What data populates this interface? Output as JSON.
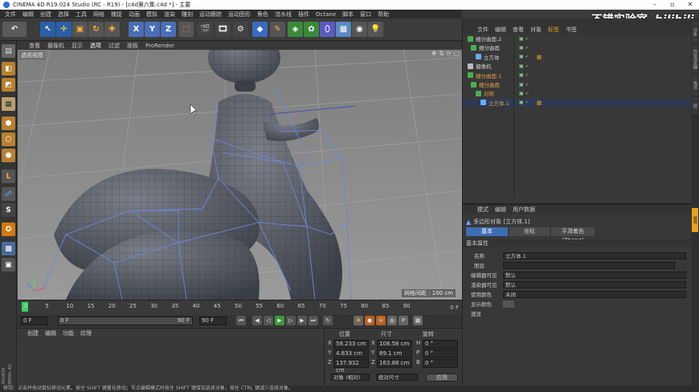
{
  "window": {
    "title": "CINEMA 4D R19.024 Studio (RC - R19) - [c4d第六集.c4d *] - 主要"
  },
  "watermark": {
    "text": "不错实验室",
    "brand": "bilibili"
  },
  "menubar": [
    "文件",
    "编辑",
    "创建",
    "选择",
    "工具",
    "网格",
    "捕捉",
    "动画",
    "模拟",
    "渲染",
    "雕刻",
    "运动跟踪",
    "运动图形",
    "角色",
    "流水线",
    "插件",
    "Octane",
    "脚本",
    "窗口",
    "帮助"
  ],
  "toolbar": {
    "axes": [
      "X",
      "Y",
      "Z"
    ]
  },
  "viewport": {
    "menu": [
      "查看",
      "摄像机",
      "显示",
      "选项",
      "过滤",
      "面板",
      "ProRender"
    ],
    "label": "透视视图",
    "grid_info": "网格间距 : 100 cm"
  },
  "timeline": {
    "ticks": [
      "0",
      "5",
      "10",
      "15",
      "20",
      "25",
      "30",
      "35",
      "40",
      "45",
      "50",
      "55",
      "60",
      "65",
      "70",
      "75",
      "80",
      "85",
      "90"
    ],
    "current_frame_label": "0 F"
  },
  "transport": {
    "start": "0 F",
    "current": "0 F",
    "range_start": "0 F",
    "range_end": "90 F",
    "end": "90 F"
  },
  "material_panel": {
    "menu": [
      "创建",
      "编辑",
      "功能",
      "纹理"
    ]
  },
  "coords": {
    "headers": [
      "位置",
      "尺寸",
      "旋转"
    ],
    "rows": [
      {
        "axis": "X",
        "pos": "58.233 cm",
        "size": "108.58 cm",
        "rlabel": "H",
        "rot": "0 °"
      },
      {
        "axis": "Y",
        "pos": "4.833 cm",
        "size": "89.1 cm",
        "rlabel": "P",
        "rot": "0 °"
      },
      {
        "axis": "Z",
        "pos": "137.932 cm",
        "size": "163.88 cm",
        "rlabel": "B",
        "rot": "0 °"
      }
    ],
    "mode": "对象 (相对)",
    "size_mode": "绝对尺寸",
    "apply": "应用"
  },
  "object_manager": {
    "menu": [
      "文件",
      "编辑",
      "查看",
      "对象",
      "标签",
      "书签"
    ],
    "objects": [
      {
        "name": "细分曲面.2",
        "color": "#cfcfcf"
      },
      {
        "name": "细分曲面",
        "color": "#cfcfcf"
      },
      {
        "name": "立方体",
        "color": "#cfcfcf"
      },
      {
        "name": "摄像机",
        "color": "#cfcfcf"
      },
      {
        "name": "细分曲面.1",
        "color": "#e0a040"
      },
      {
        "name": "细分曲面",
        "color": "#e0a040"
      },
      {
        "name": "对称",
        "color": "#e0a040"
      },
      {
        "name": "立方体.1",
        "color": "#e0a040"
      }
    ]
  },
  "attributes": {
    "menu": [
      "模式",
      "编辑",
      "用户数据"
    ],
    "object_title": "多边形对象 [立方体.1]",
    "tabs": [
      "基本",
      "坐标",
      "平滑着色(Phong)"
    ],
    "section": "基本属性",
    "fields": [
      {
        "label": "名称",
        "value": "立方体.1"
      },
      {
        "label": "图层",
        "value": ""
      },
      {
        "label": "编辑器可见",
        "value": "默认"
      },
      {
        "label": "渲染器可见",
        "value": "默认"
      },
      {
        "label": "使用颜色",
        "value": "关闭"
      },
      {
        "label": "显示颜色",
        "value": ""
      },
      {
        "label": "透显",
        "value": ""
      }
    ]
  },
  "side_tabs": [
    "对象",
    "内容浏览器",
    "构造",
    "层",
    "属性"
  ],
  "left_tools": [
    "move",
    "scale",
    "rotate"
  ],
  "status": {
    "text": "移动：点击并拖动鼠标移动元素。按住 SHIFT 键量化移动；节点编辑模式时按住 SHIFT 键增加选择对象；按住 CTRL 键减少选择对象。"
  },
  "brand": {
    "maxon": "MAXON",
    "c4d": "CINEMA 4D"
  },
  "colors": {
    "accent": "#e8a020",
    "select_blue": "#3f6db4",
    "active_orange": "#e0a040"
  }
}
